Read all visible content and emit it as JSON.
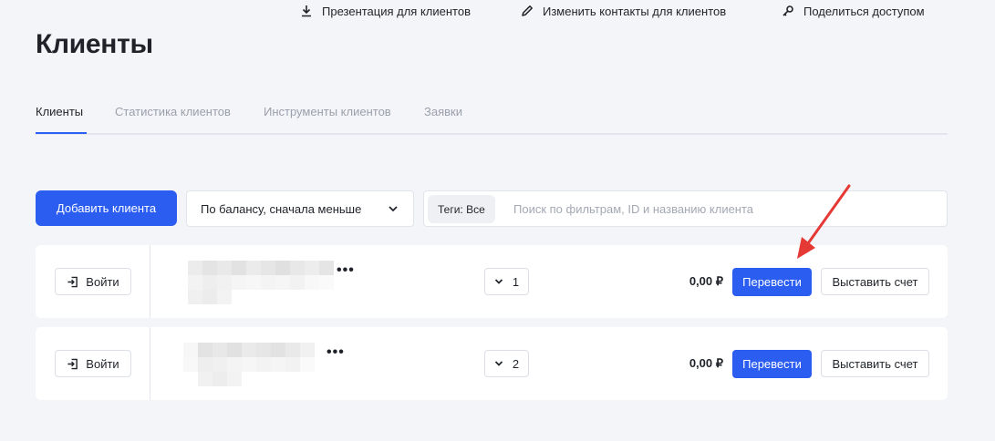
{
  "page": {
    "title": "Клиенты"
  },
  "header_actions": {
    "presentation": "Презентация для клиентов",
    "contacts": "Изменить контакты для клиентов",
    "share": "Поделиться доступом"
  },
  "tabs": [
    {
      "label": "Клиенты",
      "active": true
    },
    {
      "label": "Статистика клиентов",
      "active": false
    },
    {
      "label": "Инструменты клиентов",
      "active": false
    },
    {
      "label": "Заявки",
      "active": false
    }
  ],
  "toolbar": {
    "add_client": "Добавить клиента",
    "sort_value": "По балансу, сначала меньше",
    "tags_chip": "Теги: Все",
    "search_placeholder": "Поиск по фильтрам, ID и названию клиента"
  },
  "clients": [
    {
      "login": "Войти",
      "count": "1",
      "balance": "0,00 ₽",
      "transfer": "Перевести",
      "invoice": "Выставить счет"
    },
    {
      "login": "Войти",
      "count": "2",
      "balance": "0,00 ₽",
      "transfer": "Перевести",
      "invoice": "Выставить счет"
    }
  ],
  "colors": {
    "accent": "#2b5df0",
    "annotation_arrow": "#e53935"
  },
  "icons": {
    "presentation": "download-icon",
    "contacts": "pencil-icon",
    "share": "key-icon",
    "sort": "chevron-down-icon",
    "login": "login-icon",
    "count": "chevron-down-icon",
    "more": "more-dots-icon"
  }
}
